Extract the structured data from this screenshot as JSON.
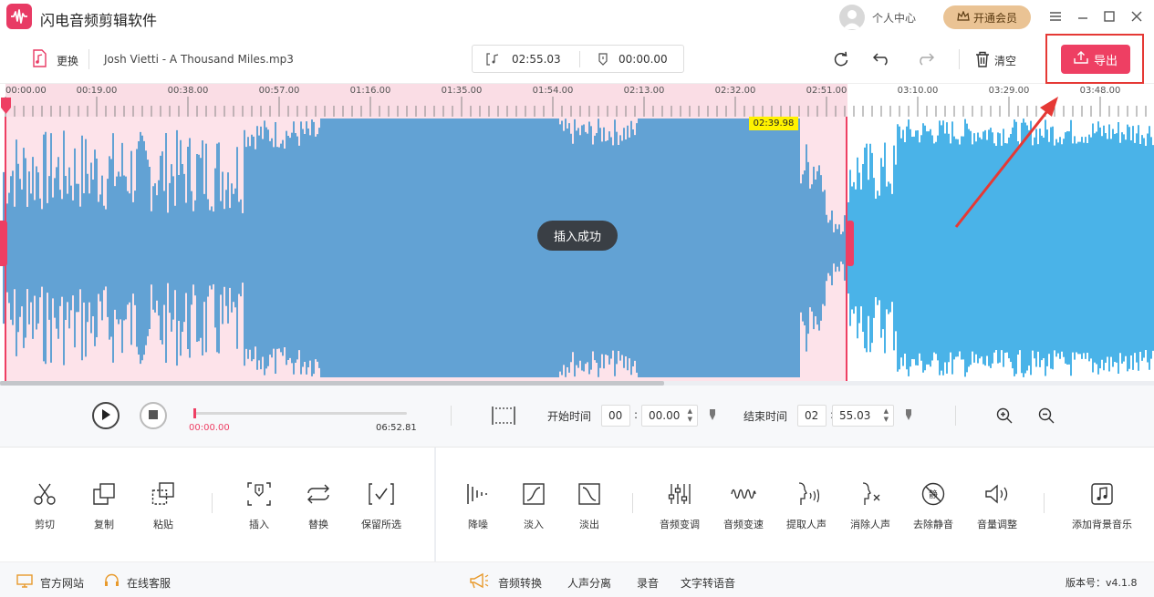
{
  "app": {
    "title": "闪电音频剪辑软件"
  },
  "header": {
    "user_label": "个人中心",
    "vip_label": "开通会员"
  },
  "toolbar": {
    "replace_label": "更换",
    "file_name": "Josh Vietti - A Thousand Miles.mp3",
    "duration": "02:55.03",
    "cursor_time": "00:00.00",
    "clear_label": "清空",
    "export_label": "导出"
  },
  "ruler": {
    "ticks": [
      "00:00.00",
      "00:19.00",
      "00:38.00",
      "00:57.00",
      "01:16.00",
      "01:35.00",
      "01:54.00",
      "02:13.00",
      "02:32.00",
      "02:51.00",
      "03:10.00",
      "03:29.00",
      "03:48.00"
    ]
  },
  "selection": {
    "start_fraction": 0.0,
    "end_fraction": 0.7337
  },
  "waveform": {
    "playhead_tag": "02:39.98",
    "toast": "插入成功"
  },
  "transport": {
    "current_time": "00:00.00",
    "total_time": "06:52.81",
    "progress": 0.0,
    "start_label": "开始时间",
    "start_min": "00",
    "start_sec": "00.00",
    "end_label": "结束时间",
    "end_min": "02",
    "end_sec": "55.03"
  },
  "tools": {
    "cut": "剪切",
    "copy": "复制",
    "paste": "粘贴",
    "insert": "插入",
    "replace": "替换",
    "keep_selection": "保留所选",
    "denoise": "降噪",
    "fade_in": "淡入",
    "fade_out": "淡出",
    "pitch": "音频变调",
    "speed": "音频变速",
    "extract_voice": "提取人声",
    "remove_voice": "消除人声",
    "remove_silence": "去除静音",
    "volume": "音量调整",
    "add_bgm": "添加背景音乐"
  },
  "footer": {
    "website": "官方网站",
    "support": "在线客服",
    "audio_convert": "音频转换",
    "voice_separation": "人声分离",
    "record": "录音",
    "tts": "文字转语音",
    "version": "版本号：v4.1.8"
  },
  "colors": {
    "accent": "#ee3f63",
    "wave_selected": "#62a2d4",
    "wave_unselected": "#4ab3e8",
    "selection_bg": "#fde3ea",
    "vip": "#eac394"
  },
  "icons": [
    "app-logo-icon",
    "user-avatar-icon",
    "crown-icon",
    "menu-icon",
    "minimize-icon",
    "maximize-icon",
    "close-icon",
    "music-file-icon",
    "bracket-note-icon",
    "marker-icon",
    "refresh-icon",
    "undo-icon",
    "redo-icon",
    "trash-icon",
    "upload-icon",
    "play-icon",
    "stop-icon",
    "selection-range-icon",
    "zoom-in-icon",
    "zoom-out-icon",
    "scissors-icon",
    "copy-icon",
    "paste-icon",
    "insert-icon",
    "replace-icon",
    "keep-selection-icon",
    "denoise-icon",
    "fade-in-icon",
    "fade-out-icon",
    "pitch-icon",
    "speed-icon",
    "extract-voice-icon",
    "remove-voice-icon",
    "remove-silence-icon",
    "volume-icon",
    "add-music-icon",
    "monitor-icon",
    "headset-icon",
    "megaphone-icon"
  ]
}
